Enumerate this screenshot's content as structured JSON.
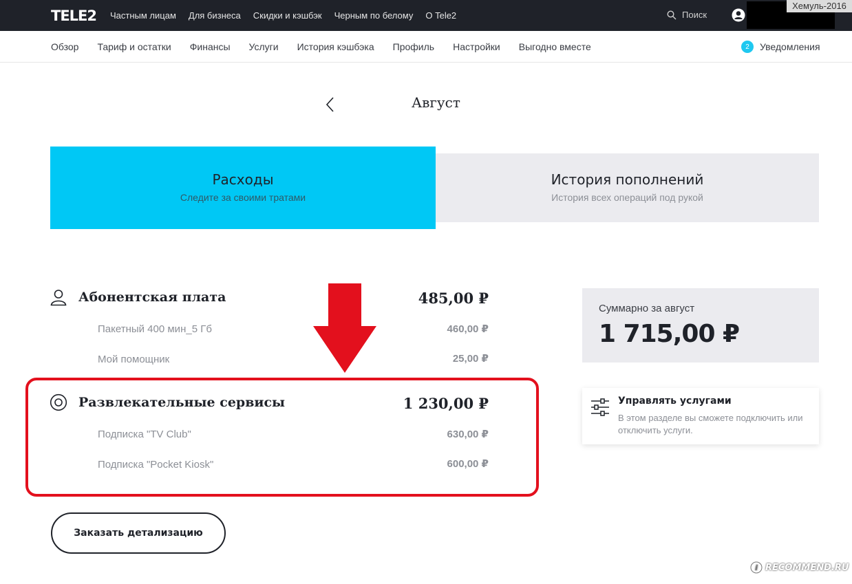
{
  "topbar": {
    "logo": "TELE2",
    "nav": [
      "Частным лицам",
      "Для бизнеса",
      "Скидки и кэшбэк",
      "Черным по белому",
      "О Tele2"
    ],
    "search_label": "Поиск",
    "watermark_user": "Хемуль-2016"
  },
  "subnav": {
    "items": [
      "Обзор",
      "Тариф и остатки",
      "Финансы",
      "Услуги",
      "История кэшбэка",
      "Профиль",
      "Настройки",
      "Выгодно вместе"
    ],
    "notifications_count": "2",
    "notifications_label": "Уведомления"
  },
  "month": {
    "label": "Август"
  },
  "tabs": [
    {
      "title": "Расходы",
      "subtitle": "Следите за своими тратами"
    },
    {
      "title": "История пополнений",
      "subtitle": "История всех операций под рукой"
    }
  ],
  "charges": [
    {
      "title": "Абонентская плата",
      "total": "485,00 ₽",
      "items": [
        {
          "label": "Пакетный 400 мин_5 Гб",
          "value": "460,00 ₽"
        },
        {
          "label": "Мой помощник",
          "value": "25,00 ₽"
        }
      ]
    },
    {
      "title": "Развлекательные сервисы",
      "total": "1 230,00 ₽",
      "items": [
        {
          "label": "Подписка \"TV Club\"",
          "value": "630,00 ₽"
        },
        {
          "label": "Подписка \"Pocket Kiosk\"",
          "value": "600,00 ₽"
        }
      ]
    }
  ],
  "order_button": "Заказать детализацию",
  "summary": {
    "label": "Суммарно за август",
    "value": "1 715,00 ₽"
  },
  "manage": {
    "title": "Управлять услугами",
    "description": "В этом разделе вы сможете подключить или отключить услуги."
  },
  "watermark_site": "RECOMMEND.RU",
  "colors": {
    "accent": "#00c8f5",
    "highlight": "#e3101d",
    "dark": "#1f2229"
  }
}
